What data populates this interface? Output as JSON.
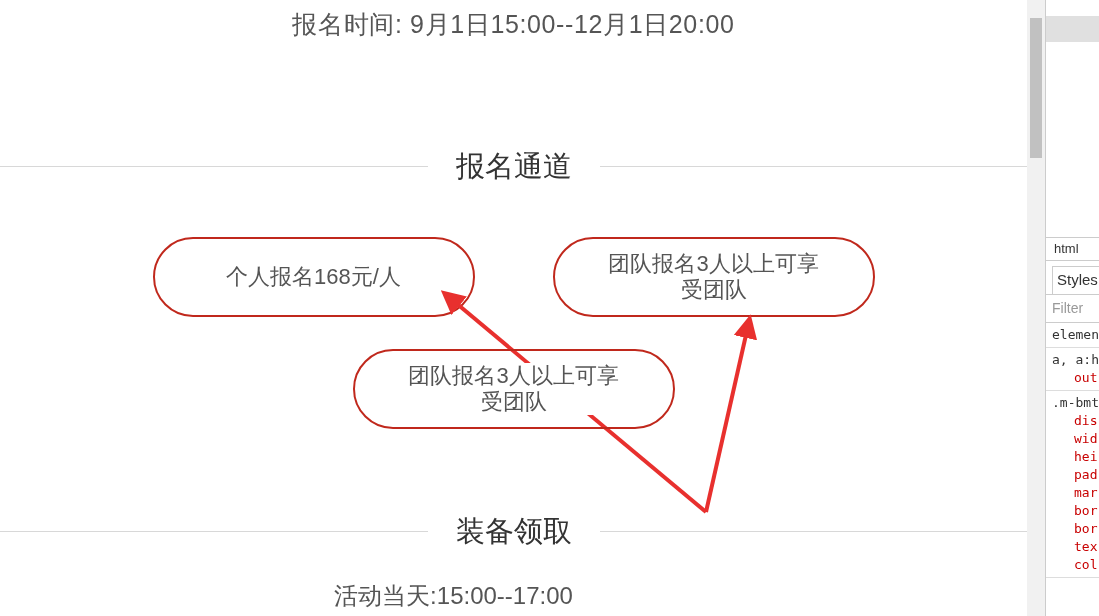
{
  "signup_time": "报名时间: 9月1日15:00--12月1日20:00",
  "sections": [
    {
      "heading": "报名通道",
      "buttons": [
        "个人报名168元/人",
        "团队报名3人以上可享受团队",
        "团队报名3人以上可享受团队"
      ]
    },
    {
      "heading": "装备领取",
      "text": "活动当天:15:00--17:00"
    }
  ],
  "devtools": {
    "breadcrumb": "html",
    "tab": "Styles",
    "filter_placeholder": "Filter",
    "rules": [
      {
        "selector": "elemen"
      },
      {
        "selector": "a, a:h",
        "props": [
          "out"
        ]
      },
      {
        "selector": ".m-bmt",
        "props": [
          "dis",
          "wid",
          "hei",
          "pad",
          "mar",
          "bor",
          "bor",
          "tex",
          "col"
        ]
      }
    ]
  }
}
